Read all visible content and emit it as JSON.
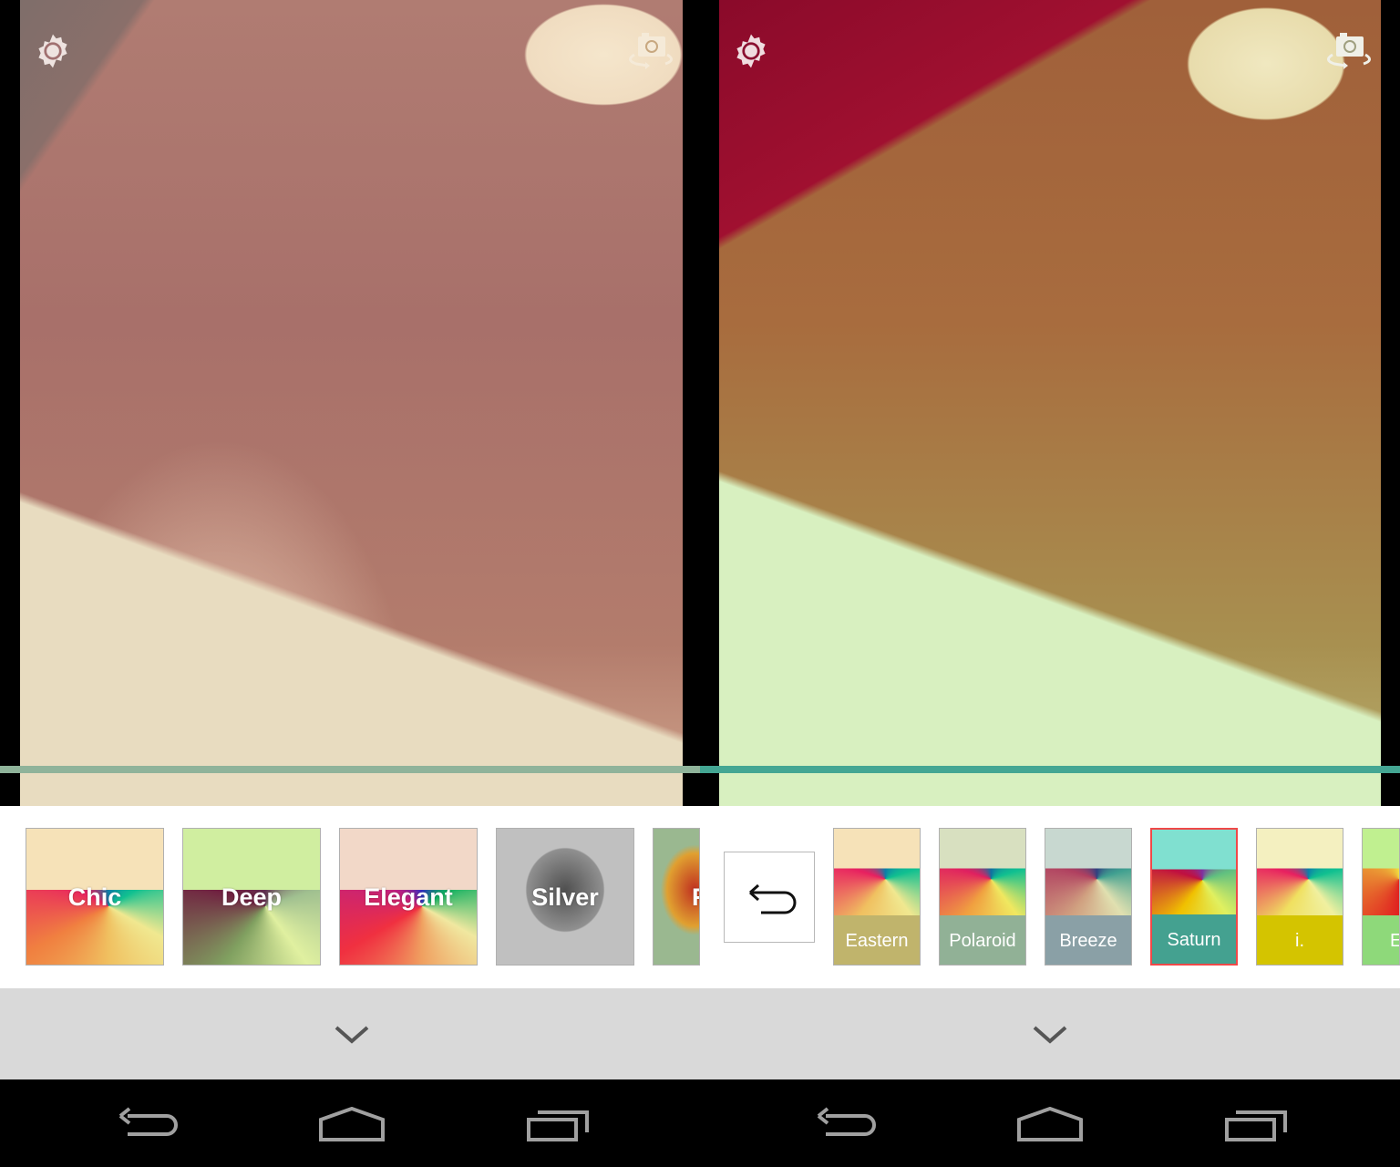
{
  "left_screen": {
    "icons": {
      "settings": "gear-icon",
      "switch_camera": "camera-switch-icon"
    },
    "progress_colors": [
      "#8fb39a",
      "#44a693"
    ],
    "filters": [
      {
        "label": "Chic",
        "tint": "#f6e2b8"
      },
      {
        "label": "Deep",
        "tint": "#d0eea0"
      },
      {
        "label": "Elegant",
        "tint": "#f2d8c8"
      },
      {
        "label": "Silver",
        "tint": "#c0c0c0"
      },
      {
        "label": "F",
        "tint": "#9ab890"
      }
    ],
    "collapse_icon": "chevron-down-icon",
    "nav": [
      "back-icon",
      "home-icon",
      "recents-icon"
    ]
  },
  "right_screen": {
    "icons": {
      "settings": "gear-icon",
      "switch_camera": "camera-switch-icon"
    },
    "undo_icon": "undo-arrow-icon",
    "filters": [
      {
        "label": "Eastern",
        "color": "#c0b46c",
        "selected": false
      },
      {
        "label": "Polaroid",
        "color": "#91b196",
        "selected": false
      },
      {
        "label": "Breeze",
        "color": "#8aa0a6",
        "selected": false
      },
      {
        "label": "Saturn",
        "color": "#44a190",
        "selected": true
      },
      {
        "label": "i.",
        "color": "#d4c400",
        "selected": false
      },
      {
        "label": "E",
        "color": "#8ed97a",
        "selected": false
      }
    ],
    "selected_border": "#f04848",
    "collapse_icon": "chevron-down-icon",
    "nav": [
      "back-icon",
      "home-icon",
      "recents-icon"
    ]
  }
}
